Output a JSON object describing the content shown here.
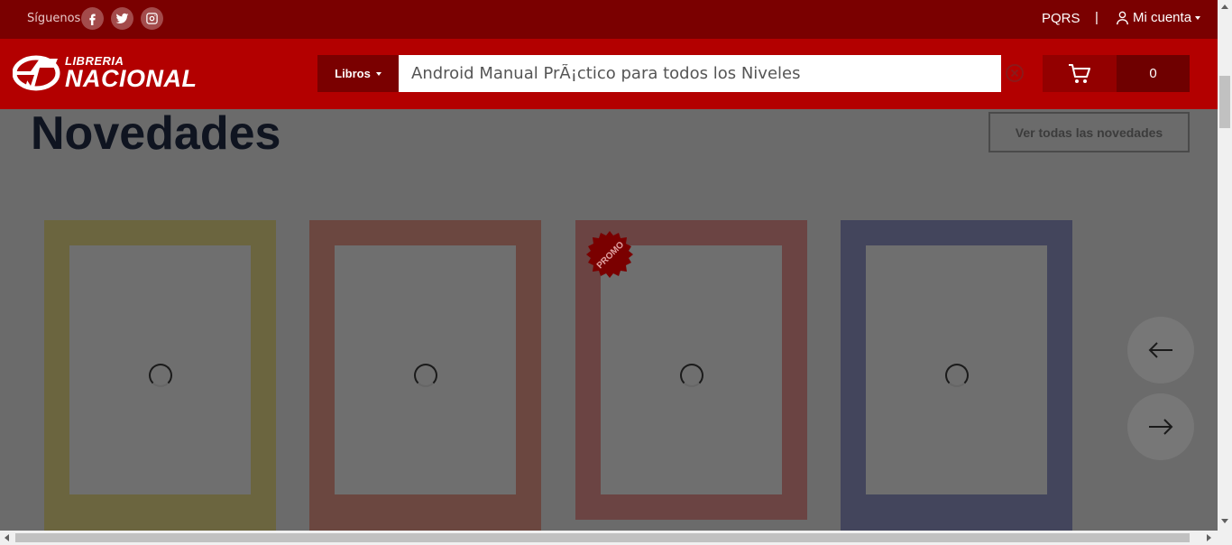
{
  "topbar": {
    "follow_label": "Síguenos",
    "social": [
      "facebook-icon",
      "twitter-icon",
      "instagram-icon"
    ],
    "pqrs": "PQRS",
    "separator": "|",
    "account": "Mi cuenta"
  },
  "header": {
    "logo_small": "LIBRERIA",
    "logo_big": "NACIONAL",
    "category": "Libros",
    "search_value": "Android Manual PrÃ¡ctico para todos los Niveles",
    "cart_count": "0"
  },
  "section": {
    "title": "Novedades",
    "view_all": "Ver todas las novedades"
  },
  "cards": [
    {
      "color": "#6b653f",
      "promo": false
    },
    {
      "color": "#6b4740",
      "promo": false
    },
    {
      "color": "#6b4443",
      "promo": true,
      "promo_label": "PROMO"
    },
    {
      "color": "#43455c",
      "promo": false
    }
  ],
  "colors": {
    "topbar": "#7a0000",
    "header": "#b30000",
    "overlay": "#6b6b6b"
  }
}
